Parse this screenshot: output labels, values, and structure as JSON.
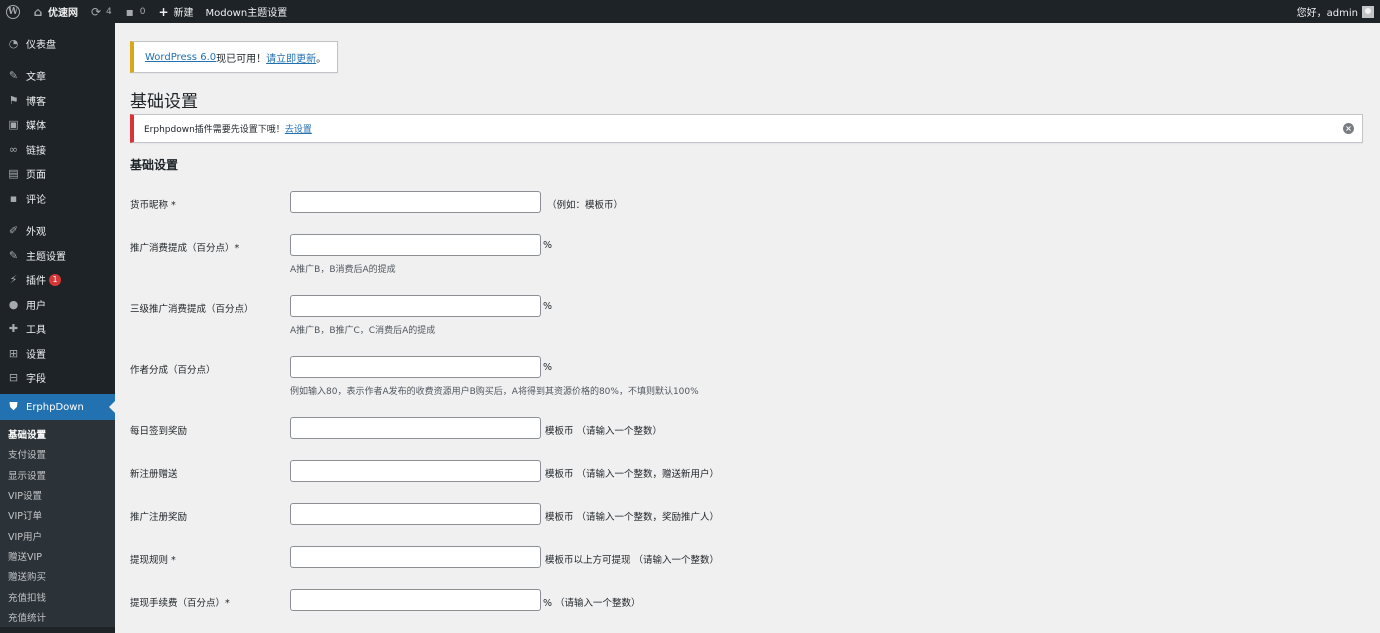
{
  "adminbar": {
    "site_name": "优速网",
    "updates_count": "4",
    "comments_count": "0",
    "new_label": "新建",
    "theme_settings": "Modown主题设置",
    "greeting": "您好，admin"
  },
  "sidebar": {
    "items": [
      {
        "label": "仪表盘"
      },
      {
        "label": "文章"
      },
      {
        "label": "博客"
      },
      {
        "label": "媒体"
      },
      {
        "label": "链接"
      },
      {
        "label": "页面"
      },
      {
        "label": "评论"
      },
      {
        "label": "外观"
      },
      {
        "label": "主题设置"
      },
      {
        "label": "插件",
        "badge": "1"
      },
      {
        "label": "用户"
      },
      {
        "label": "工具"
      },
      {
        "label": "设置"
      },
      {
        "label": "字段"
      }
    ],
    "current": "ErphpDown",
    "submenu": [
      "基础设置",
      "支付设置",
      "显示设置",
      "VIP设置",
      "VIP订单",
      "VIP用户",
      "赠送VIP",
      "赠送购买",
      "充值扣钱",
      "充值统计"
    ]
  },
  "notice_update": {
    "link": "WordPress 6.0",
    "text": "现已可用！",
    "action": "请立即更新",
    "end": "。"
  },
  "page_title": "基础设置",
  "notice_error": {
    "text": "Erphpdown插件需要先设置下哦！",
    "link": "去设置"
  },
  "section_title": "基础设置",
  "fields": [
    {
      "label": "货币昵称 *",
      "value": "",
      "suffix": "（例如：模板币）",
      "desc": ""
    },
    {
      "label": "推广消费提成（百分点）*",
      "value": "",
      "suffix": "%",
      "desc": "A推广B，B消费后A的提成"
    },
    {
      "label": "三级推广消费提成（百分点）",
      "value": "",
      "suffix": "%",
      "desc": "A推广B，B推广C，C消费后A的提成"
    },
    {
      "label": "作者分成（百分点）",
      "value": "",
      "suffix": "%",
      "desc": "例如输入80，表示作者A发布的收费资源用户B购买后，A将得到其资源价格的80%，不填则默认100%"
    },
    {
      "label": "每日签到奖励",
      "value": "",
      "suffix": "模板币 （请输入一个整数）",
      "desc": ""
    },
    {
      "label": "新注册赠送",
      "value": "",
      "suffix": "模板币 （请输入一个整数，赠送新用户）",
      "desc": ""
    },
    {
      "label": "推广注册奖励",
      "value": "",
      "suffix": "模板币 （请输入一个整数，奖励推广人）",
      "desc": ""
    },
    {
      "label": "提现规则 *",
      "value": "",
      "suffix": "模板币以上方可提现 （请输入一个整数）",
      "desc": ""
    },
    {
      "label": "提现手续费（百分点）*",
      "value": "",
      "suffix": "% （请输入一个整数）",
      "desc": ""
    }
  ]
}
